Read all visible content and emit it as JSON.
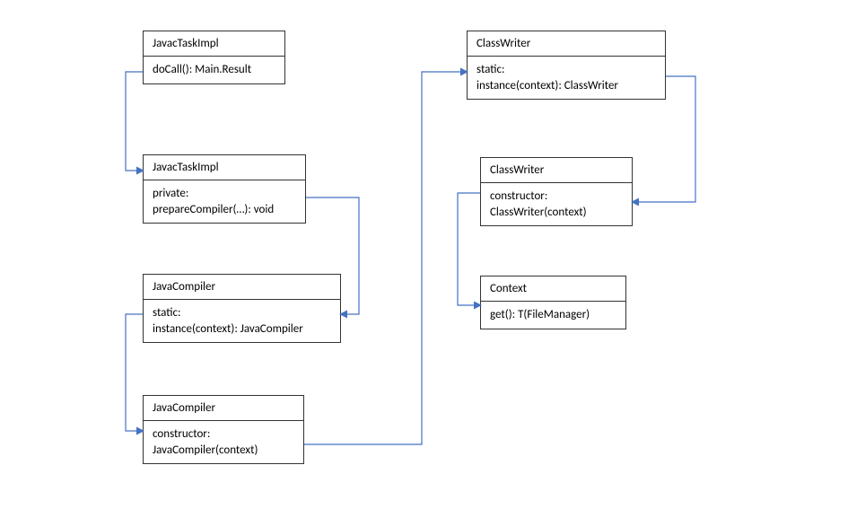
{
  "boxes": {
    "b1": {
      "title": "JavacTaskImpl",
      "body": "doCall(): Main.Result"
    },
    "b2": {
      "title": "JavacTaskImpl",
      "body": "private:\nprepareCompiler(…):  void"
    },
    "b3": {
      "title": "JavaCompiler",
      "body": "static:\ninstance(context): JavaCompiler"
    },
    "b4": {
      "title": "JavaCompiler",
      "body": "constructor:\nJavaCompiler(context)"
    },
    "b5": {
      "title": "ClassWriter",
      "body": "static:\ninstance(context): ClassWriter"
    },
    "b6": {
      "title": "ClassWriter",
      "body": "constructor:\nClassWriter(context)"
    },
    "b7": {
      "title": "Context",
      "body": "get(): T(FileManager)"
    }
  },
  "style": {
    "arrow_color": "#4472C4",
    "border_color": "#333333"
  }
}
